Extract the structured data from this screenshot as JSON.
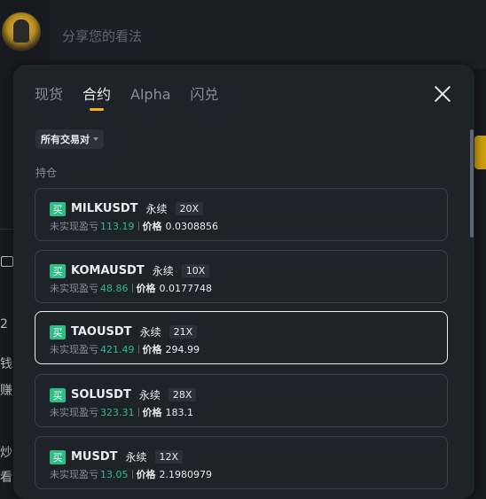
{
  "post": {
    "placeholder": "分享您的看法"
  },
  "background_fragments": [
    "2",
    "钱",
    "赚",
    "炒",
    "看"
  ],
  "tabs": [
    {
      "label": "现货",
      "active": false
    },
    {
      "label": "合约",
      "active": true
    },
    {
      "label": "Alpha",
      "active": false
    },
    {
      "label": "闪兑",
      "active": false
    }
  ],
  "filter": {
    "label": "所有交易对"
  },
  "section_title": "持仓",
  "positions": [
    {
      "side": "买",
      "symbol": "MILKUSDT",
      "type": "永续",
      "leverage": "20X",
      "pnl_label": "未实现盈亏",
      "pnl": "113.19",
      "price_label": "价格",
      "price": "0.0308856",
      "selected": false
    },
    {
      "side": "买",
      "symbol": "KOMAUSDT",
      "type": "永续",
      "leverage": "10X",
      "pnl_label": "未实现盈亏",
      "pnl": "48.86",
      "price_label": "价格",
      "price": "0.0177748",
      "selected": false
    },
    {
      "side": "买",
      "symbol": "TAOUSDT",
      "type": "永续",
      "leverage": "21X",
      "pnl_label": "未实现盈亏",
      "pnl": "421.49",
      "price_label": "价格",
      "price": "294.99",
      "selected": true
    },
    {
      "side": "买",
      "symbol": "SOLUSDT",
      "type": "永续",
      "leverage": "28X",
      "pnl_label": "未实现盈亏",
      "pnl": "323.31",
      "price_label": "价格",
      "price": "183.1",
      "selected": false
    },
    {
      "side": "买",
      "symbol": "MUSDT",
      "type": "永续",
      "leverage": "12X",
      "pnl_label": "未实现盈亏",
      "pnl": "13.05",
      "price_label": "价格",
      "price": "2.1980979",
      "selected": false
    }
  ],
  "colors": {
    "accent": "#f0b90b",
    "positive": "#2ebd85",
    "panel": "#1e2329",
    "muted": "#848e9c"
  }
}
